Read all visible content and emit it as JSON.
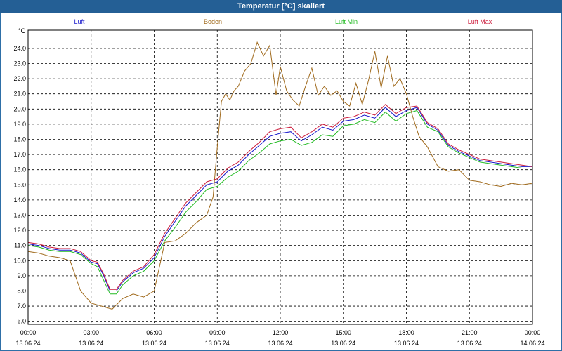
{
  "window": {
    "title": "Temperatur [°C] skaliert"
  },
  "chart_data": {
    "type": "line",
    "title": "Temperatur [°C] skaliert",
    "unit_label": "°C",
    "ylim": [
      5.8,
      25.2
    ],
    "yticks": [
      6.0,
      7.0,
      8.0,
      9.0,
      10.0,
      11.0,
      12.0,
      13.0,
      14.0,
      15.0,
      16.0,
      17.0,
      18.0,
      19.0,
      20.0,
      21.0,
      22.0,
      23.0,
      24.0
    ],
    "xlim": [
      0,
      24
    ],
    "xticks": [
      {
        "h": 0,
        "time": "00:00",
        "date": "13.06.24"
      },
      {
        "h": 3,
        "time": "03:00",
        "date": "13.06.24"
      },
      {
        "h": 6,
        "time": "06:00",
        "date": "13.06.24"
      },
      {
        "h": 9,
        "time": "09:00",
        "date": "13.06.24"
      },
      {
        "h": 12,
        "time": "12:00",
        "date": "13.06.24"
      },
      {
        "h": 15,
        "time": "15:00",
        "date": "13.06.24"
      },
      {
        "h": 18,
        "time": "18:00",
        "date": "13.06.24"
      },
      {
        "h": 21,
        "time": "21:00",
        "date": "13.06.24"
      },
      {
        "h": 24,
        "time": "00:00",
        "date": "14.06.24"
      }
    ],
    "grid": true,
    "legend_position": "top",
    "series": [
      {
        "name": "Luft",
        "color": "#1a1acc",
        "x": [
          0,
          0.5,
          1,
          1.5,
          2,
          2.5,
          3,
          3.3,
          3.6,
          3.9,
          4.2,
          4.5,
          5,
          5.5,
          6,
          6.5,
          7,
          7.5,
          8,
          8.5,
          9,
          9.5,
          10,
          10.5,
          11,
          11.5,
          12,
          12.5,
          13,
          13.5,
          14,
          14.5,
          15,
          15.5,
          16,
          16.5,
          17,
          17.5,
          18,
          18.5,
          19,
          19.5,
          20,
          20.5,
          21,
          21.5,
          22,
          22.5,
          23,
          23.5,
          24
        ],
        "y": [
          11.1,
          11.0,
          10.8,
          10.7,
          10.7,
          10.5,
          9.9,
          9.8,
          9.0,
          8.0,
          8.0,
          8.6,
          9.2,
          9.5,
          10.2,
          11.6,
          12.6,
          13.6,
          14.3,
          15.0,
          15.2,
          15.9,
          16.3,
          17.0,
          17.6,
          18.2,
          18.4,
          18.5,
          17.9,
          18.3,
          18.8,
          18.6,
          19.2,
          19.3,
          19.6,
          19.4,
          20.1,
          19.5,
          19.9,
          20.1,
          19.0,
          18.6,
          17.6,
          17.2,
          16.9,
          16.6,
          16.5,
          16.4,
          16.3,
          16.2,
          16.2
        ]
      },
      {
        "name": "Boden",
        "color": "#a06a1c",
        "x": [
          0,
          0.5,
          1,
          1.5,
          2,
          2.5,
          3,
          3.5,
          4,
          4.5,
          5,
          5.5,
          6,
          6.5,
          7,
          7.5,
          8,
          8.5,
          8.8,
          9,
          9.2,
          9.4,
          9.6,
          9.8,
          10,
          10.3,
          10.6,
          10.9,
          11.2,
          11.5,
          11.8,
          12,
          12.3,
          12.6,
          12.9,
          13.2,
          13.5,
          13.8,
          14.1,
          14.4,
          14.7,
          15,
          15.3,
          15.6,
          15.9,
          16.2,
          16.5,
          16.8,
          17.1,
          17.4,
          17.7,
          18,
          18.3,
          18.6,
          19,
          19.5,
          20,
          20.5,
          21,
          21.5,
          22,
          22.5,
          23,
          23.5,
          24
        ],
        "y": [
          10.6,
          10.5,
          10.3,
          10.2,
          10.0,
          8.0,
          7.2,
          7.0,
          6.8,
          7.5,
          7.8,
          7.6,
          8.0,
          11.2,
          11.3,
          11.8,
          12.5,
          13.0,
          14.2,
          17.5,
          20.5,
          21.0,
          20.6,
          21.2,
          21.5,
          22.5,
          23.0,
          24.4,
          23.5,
          24.2,
          20.9,
          22.8,
          21.2,
          20.6,
          20.2,
          21.5,
          22.7,
          20.9,
          21.5,
          20.9,
          21.2,
          20.5,
          20.2,
          21.7,
          20.3,
          21.9,
          23.8,
          21.4,
          23.5,
          21.5,
          22.0,
          21.0,
          19.5,
          18.2,
          17.5,
          16.2,
          15.9,
          16.0,
          15.3,
          15.2,
          15.0,
          14.9,
          15.1,
          15.0,
          15.1
        ]
      },
      {
        "name": "Luft Min",
        "color": "#22bb22",
        "x": [
          0,
          0.5,
          1,
          1.5,
          2,
          2.5,
          3,
          3.3,
          3.6,
          3.9,
          4.2,
          4.5,
          5,
          5.5,
          6,
          6.5,
          7,
          7.5,
          8,
          8.5,
          9,
          9.5,
          10,
          10.5,
          11,
          11.5,
          12,
          12.5,
          13,
          13.5,
          14,
          14.5,
          15,
          15.5,
          16,
          16.5,
          17,
          17.5,
          18,
          18.5,
          19,
          19.5,
          20,
          20.5,
          21,
          21.5,
          22,
          22.5,
          23,
          23.5,
          24
        ],
        "y": [
          11.0,
          10.9,
          10.7,
          10.6,
          10.6,
          10.4,
          9.8,
          9.6,
          8.7,
          7.8,
          7.8,
          8.4,
          9.0,
          9.3,
          10.0,
          11.3,
          12.2,
          13.2,
          13.9,
          14.7,
          14.9,
          15.5,
          15.9,
          16.6,
          17.1,
          17.7,
          17.9,
          18.0,
          17.6,
          17.8,
          18.3,
          18.2,
          18.9,
          19.0,
          19.3,
          19.1,
          19.8,
          19.2,
          19.7,
          19.9,
          18.8,
          18.5,
          17.5,
          17.1,
          16.8,
          16.5,
          16.4,
          16.3,
          16.2,
          16.1,
          16.1
        ]
      },
      {
        "name": "Luft Max",
        "color": "#cc1a3a",
        "x": [
          0,
          0.5,
          1,
          1.5,
          2,
          2.5,
          3,
          3.3,
          3.6,
          3.9,
          4.2,
          4.5,
          5,
          5.5,
          6,
          6.5,
          7,
          7.5,
          8,
          8.5,
          9,
          9.5,
          10,
          10.5,
          11,
          11.5,
          12,
          12.5,
          13,
          13.5,
          14,
          14.5,
          15,
          15.5,
          16,
          16.5,
          17,
          17.5,
          18,
          18.5,
          19,
          19.5,
          20,
          20.5,
          21,
          21.5,
          22,
          22.5,
          23,
          23.5,
          24
        ],
        "y": [
          11.2,
          11.1,
          10.9,
          10.8,
          10.8,
          10.6,
          10.0,
          9.9,
          9.1,
          8.1,
          8.1,
          8.7,
          9.3,
          9.6,
          10.4,
          11.8,
          12.8,
          13.8,
          14.5,
          15.2,
          15.4,
          16.1,
          16.5,
          17.2,
          17.8,
          18.5,
          18.7,
          18.8,
          18.1,
          18.5,
          19.0,
          18.8,
          19.4,
          19.5,
          19.8,
          19.6,
          20.3,
          19.7,
          20.1,
          20.2,
          19.1,
          18.7,
          17.7,
          17.3,
          17.0,
          16.7,
          16.6,
          16.5,
          16.4,
          16.3,
          16.2
        ]
      }
    ]
  }
}
